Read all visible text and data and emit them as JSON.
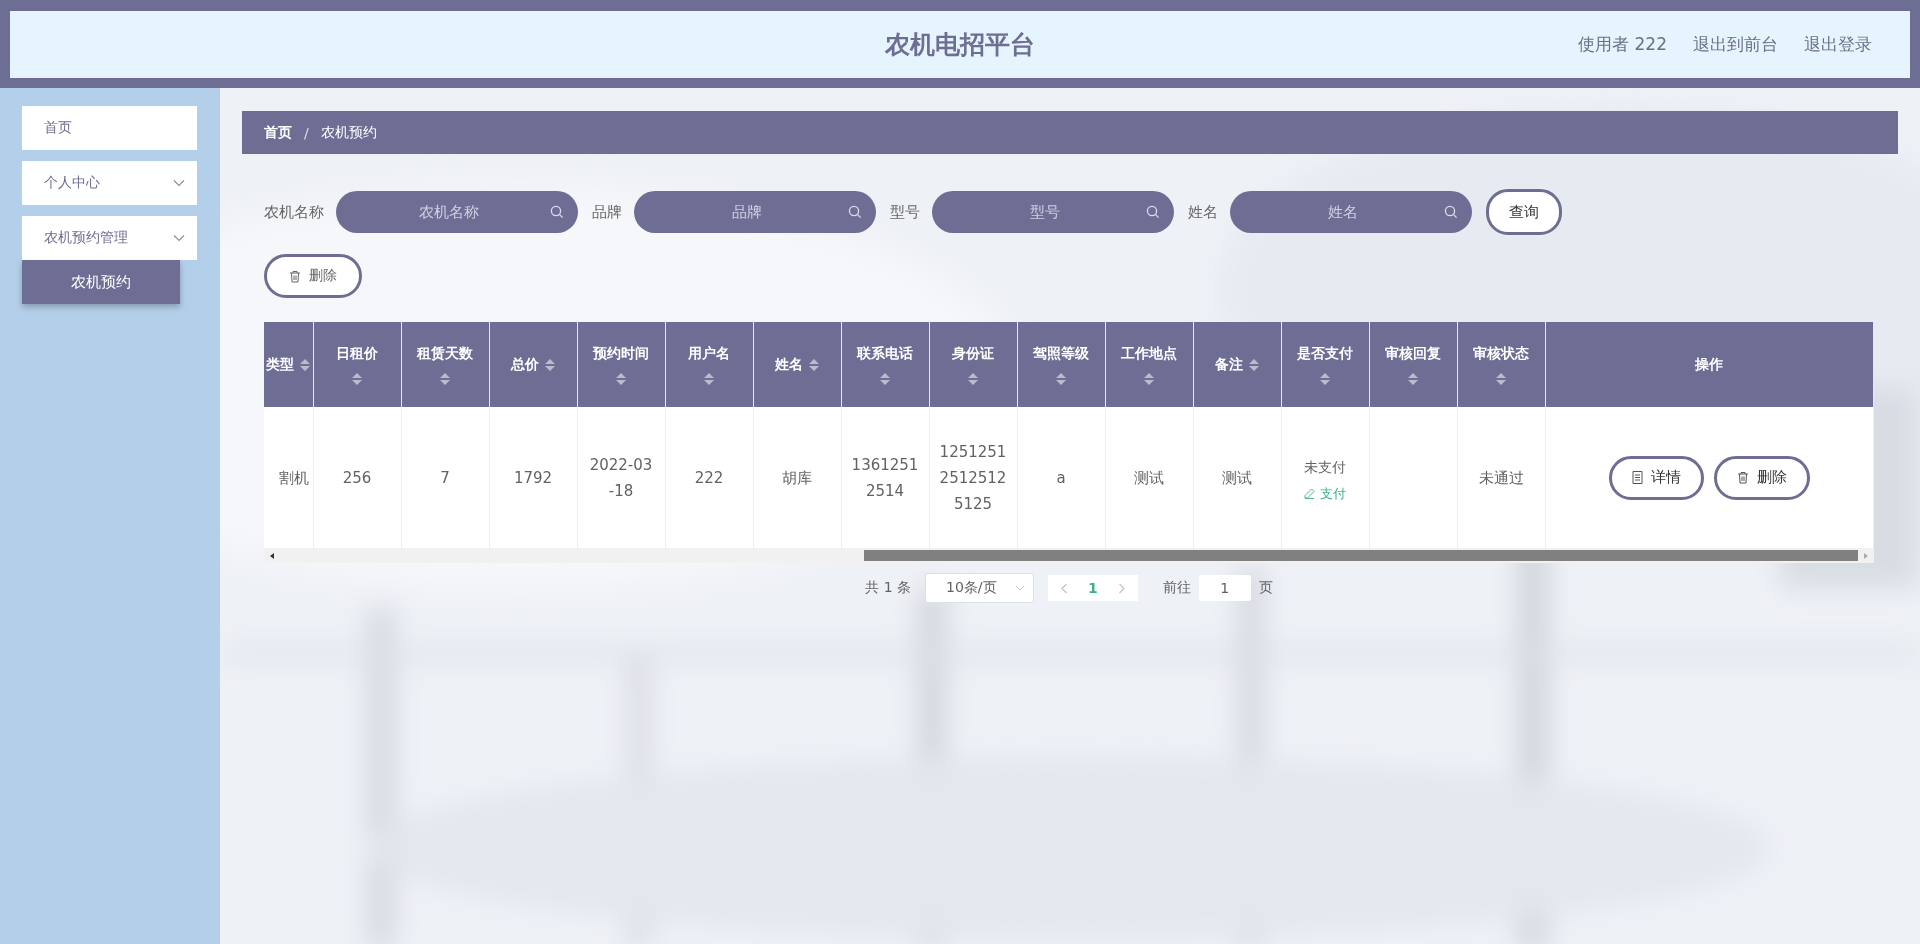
{
  "header": {
    "title": "农机电招平台",
    "links": [
      "使用者 222",
      "退出到前台",
      "退出登录"
    ]
  },
  "sidebar": {
    "items": [
      {
        "kind": "link",
        "label": "首页"
      },
      {
        "kind": "submenu",
        "label": "个人中心"
      },
      {
        "kind": "submenu",
        "label": "农机预约管理",
        "children": [
          {
            "label": "农机预约",
            "selected": true
          }
        ]
      }
    ]
  },
  "breadcrumb": {
    "items": [
      "首页",
      "农机预约"
    ],
    "separator": "/"
  },
  "filters": [
    {
      "label": "农机名称",
      "placeholder": "农机名称"
    },
    {
      "label": "品牌",
      "placeholder": "品牌"
    },
    {
      "label": "型号",
      "placeholder": "型号"
    },
    {
      "label": "姓名",
      "placeholder": "姓名"
    }
  ],
  "query_button": "查询",
  "delete_button": "删除",
  "table": {
    "columns": [
      {
        "title": "类型",
        "sortable": true
      },
      {
        "title": "日租价",
        "sortable": true
      },
      {
        "title": "租赁天数",
        "sortable": true
      },
      {
        "title": "总价",
        "sortable": true
      },
      {
        "title": "预约时间",
        "sortable": true
      },
      {
        "title": "用户名",
        "sortable": true
      },
      {
        "title": "姓名",
        "sortable": true
      },
      {
        "title": "联系电话",
        "sortable": true
      },
      {
        "title": "身份证",
        "sortable": true
      },
      {
        "title": "驾照等级",
        "sortable": true
      },
      {
        "title": "工作地点",
        "sortable": true
      },
      {
        "title": "备注",
        "sortable": true
      },
      {
        "title": "是否支付",
        "sortable": true
      },
      {
        "title": "审核回复",
        "sortable": true
      },
      {
        "title": "审核状态",
        "sortable": true
      },
      {
        "title": "操作",
        "sortable": false
      }
    ],
    "rows": [
      {
        "cells": [
          {
            "kind": "text",
            "text": "割机"
          },
          {
            "kind": "text",
            "text": "256"
          },
          {
            "kind": "text",
            "text": "7"
          },
          {
            "kind": "text",
            "text": "1792"
          },
          {
            "kind": "text",
            "text": "2022-03-18"
          },
          {
            "kind": "text",
            "text": "222"
          },
          {
            "kind": "text",
            "text": "胡库"
          },
          {
            "kind": "text",
            "text": "13612512514"
          },
          {
            "kind": "text",
            "text": "125125125125125125"
          },
          {
            "kind": "text",
            "text": "a"
          },
          {
            "kind": "text",
            "text": "测试"
          },
          {
            "kind": "text",
            "text": "测试"
          },
          {
            "kind": "payment",
            "text": "未支付",
            "action": "支付"
          },
          {
            "kind": "empty"
          },
          {
            "kind": "text",
            "text": "未通过"
          },
          {
            "kind": "actions",
            "buttons": [
              {
                "kind": "detail",
                "label": "详情"
              },
              {
                "kind": "delete",
                "label": "删除"
              }
            ]
          }
        ]
      }
    ]
  },
  "pagination": {
    "total": "共 1 条",
    "page_size": "10条/页",
    "pages": [
      {
        "label": "1",
        "selected": true
      }
    ],
    "goto_label": "前往",
    "goto_value": "1",
    "goto_suffix": "页"
  }
}
